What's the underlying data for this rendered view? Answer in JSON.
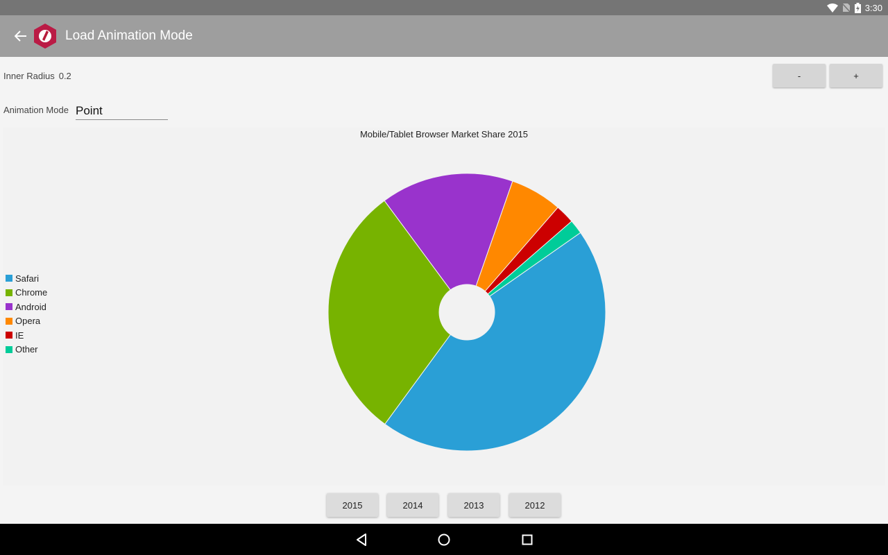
{
  "status_bar": {
    "time": "3:30",
    "icons": [
      "wifi-icon",
      "no-sim-icon",
      "battery-charging-icon"
    ]
  },
  "app_bar": {
    "title": "Load Animation Mode",
    "back_icon": "arrow-back-icon",
    "logo_icon": "app-logo-icon",
    "background": "#9e9e9e"
  },
  "controls": {
    "inner_radius_label": "Inner Radius",
    "inner_radius_value": "0.2",
    "minus_label": "-",
    "plus_label": "+",
    "animation_mode_label": "Animation Mode",
    "animation_mode_value": "Point"
  },
  "chart_data": {
    "type": "pie",
    "title": "Mobile/Tablet Browser Market Share 2015",
    "inner_radius": 0.2,
    "legend_position": "left",
    "slices": [
      {
        "name": "Safari",
        "value": 46.0,
        "color": "#2a9fd6"
      },
      {
        "name": "Chrome",
        "value": 30.6,
        "color": "#77b300"
      },
      {
        "name": "Android",
        "value": 15.9,
        "color": "#9933cc"
      },
      {
        "name": "Opera",
        "value": 6.2,
        "color": "#ff8800"
      },
      {
        "name": "IE",
        "value": 2.3,
        "color": "#cc0000"
      },
      {
        "name": "Other",
        "value": 1.7,
        "color": "#00cc99"
      }
    ]
  },
  "year_buttons": [
    "2015",
    "2014",
    "2013",
    "2012"
  ],
  "nav_bar": {
    "icons": [
      "nav-back-icon",
      "nav-home-icon",
      "nav-recents-icon"
    ]
  }
}
